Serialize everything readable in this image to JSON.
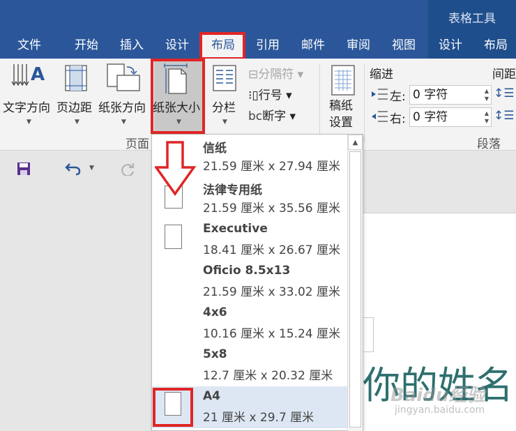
{
  "context_title": "表格工具",
  "tabs": [
    {
      "label": "文件"
    },
    {
      "label": "开始"
    },
    {
      "label": "插入"
    },
    {
      "label": "设计"
    },
    {
      "label": "布局"
    },
    {
      "label": "引用"
    },
    {
      "label": "邮件"
    },
    {
      "label": "审阅"
    },
    {
      "label": "视图"
    },
    {
      "label": "设计"
    },
    {
      "label": "布局"
    }
  ],
  "active_tab": "布局",
  "ribbon": {
    "text_direction": "文字方向",
    "margins": "页边距",
    "orientation": "纸张方向",
    "size": "纸张大小",
    "columns": "分栏",
    "breaks": "分隔符",
    "line_numbers": "行号",
    "hyphenation": "断字",
    "draft_setup": [
      "稿纸",
      "设置"
    ],
    "page_group_label": "页面",
    "indent_title": "缩进",
    "indent_left_label": "左:",
    "indent_left_value": "0 字符",
    "indent_right_label": "右:",
    "indent_right_value": "0 字符",
    "spacing_title": "间距",
    "paragraph_group_label": "段落"
  },
  "paper_sizes": [
    {
      "name": "信纸",
      "dims": "21.59 厘米 x 27.94 厘米"
    },
    {
      "name": "法律专用纸",
      "dims": "21.59 厘米 x 35.56 厘米"
    },
    {
      "name": "Executive",
      "dims": "18.41 厘米 x 26.67 厘米"
    },
    {
      "name": "Oficio 8.5x13",
      "dims": "21.59 厘米 x 33.02 厘米"
    },
    {
      "name": "4x6",
      "dims": "10.16 厘米 x 15.24 厘米"
    },
    {
      "name": "5x8",
      "dims": "12.7 厘米 x 20.32 厘米"
    },
    {
      "name": "A4",
      "dims": "21 厘米 x 29.7 厘米"
    }
  ],
  "selected_paper": "A4",
  "document": {
    "visible_text": "你的姓名"
  },
  "watermark": {
    "brand": "Baidu经验",
    "url": "jingyan.baidu.com"
  },
  "colors": {
    "title_bar": "#2b579a",
    "highlight_red": "#e02525",
    "doc_text": "#2e6f6f",
    "selected_item": "#dde7f3"
  },
  "icons": [
    "save-icon",
    "undo-icon",
    "redo-icon",
    "scroll-up-icon",
    "down-arrow-annotation-icon"
  ]
}
